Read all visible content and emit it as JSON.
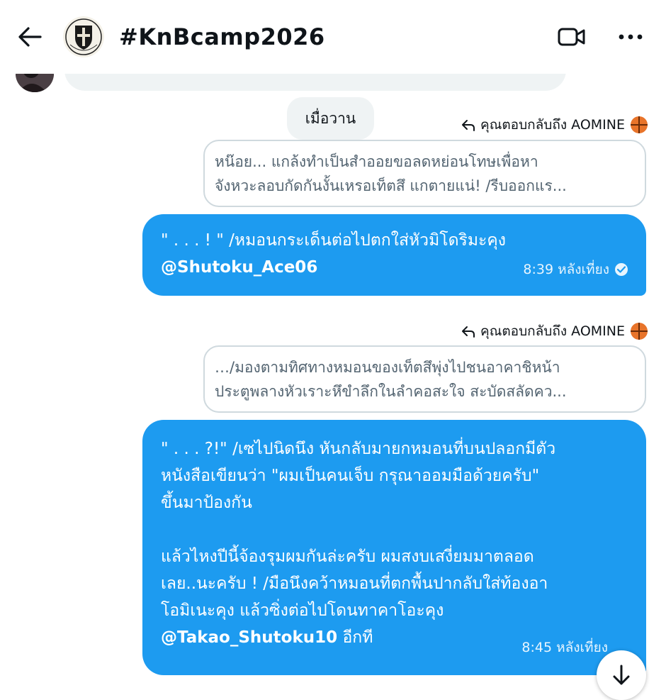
{
  "header": {
    "title": "#KnBcamp2026",
    "back_icon": "arrow-left-icon",
    "video_icon": "video-camera-icon",
    "more_icon": "more-horizontal-icon"
  },
  "date_separator": "เมื่อวาน",
  "messages": [
    {
      "reply_context": "คุณตอบกลับถึง AOMINE",
      "reply_icon": "reply-arrow-icon",
      "reply_emoji": "basketball-icon",
      "quoted_lines": [
        "หน๊อย... แกล้งทำเป็นสำออยขอลดหย่อนโทษเพื่อหา",
        "จังหวะลอบกัดกันงั้นเหรอเท็ตสึ แกตายแน่! /รีบออกแร..."
      ],
      "body_lines": [
        "\" . . . ! \" /หมอนกระเด็นต่อไปตกใส่หัวมิโดริมะคุง"
      ],
      "mention": "@Shutoku_Ace06",
      "mention_suffix": "",
      "time": "8:39 หลังเที่ยง"
    },
    {
      "reply_context": "คุณตอบกลับถึง AOMINE",
      "reply_icon": "reply-arrow-icon",
      "reply_emoji": "basketball-icon",
      "quoted_lines": [
        "…/มองตามทิศทางหมอนของเท็ตสึพุ่งไปชนอาคาชิหน้า",
        "ประตูพลางหัวเราะหึขำลึกในลำคอสะใจ สะบัดสลัดคว..."
      ],
      "body_lines": [
        "\" . . . ?!\" /เซไปนิดนึง หันกลับมายกหมอนที่บนปลอกมีตัว",
        "หนังสือเขียนว่า \"ผมเป็นคนเจ็บ กรุณาออมมือด้วยครับ\"",
        "ขึ้นมาป้องกัน",
        "",
        "แล้วไหงปีนี้จ้องรุมผมกันล่ะครับ ผมสงบเสงี่ยมมาตลอด",
        "เลย..นะครับ ! /มือนึงคว้าหมอนที่ตกพื้นปากลับใส่ท้องอา",
        "โอมิเนะคุง แล้วซิ่งต่อไปโดนทาคาโอะคุง"
      ],
      "mention": "@Takao_Shutoku10",
      "mention_suffix": " อีกที",
      "time": "8:45 หลังเที่ยง"
    }
  ],
  "scroll_icon": "arrow-down-icon",
  "colors": {
    "bubble": "#1d9bf0",
    "quote_border": "#cfd9de",
    "chip_bg": "#eff3f4"
  }
}
